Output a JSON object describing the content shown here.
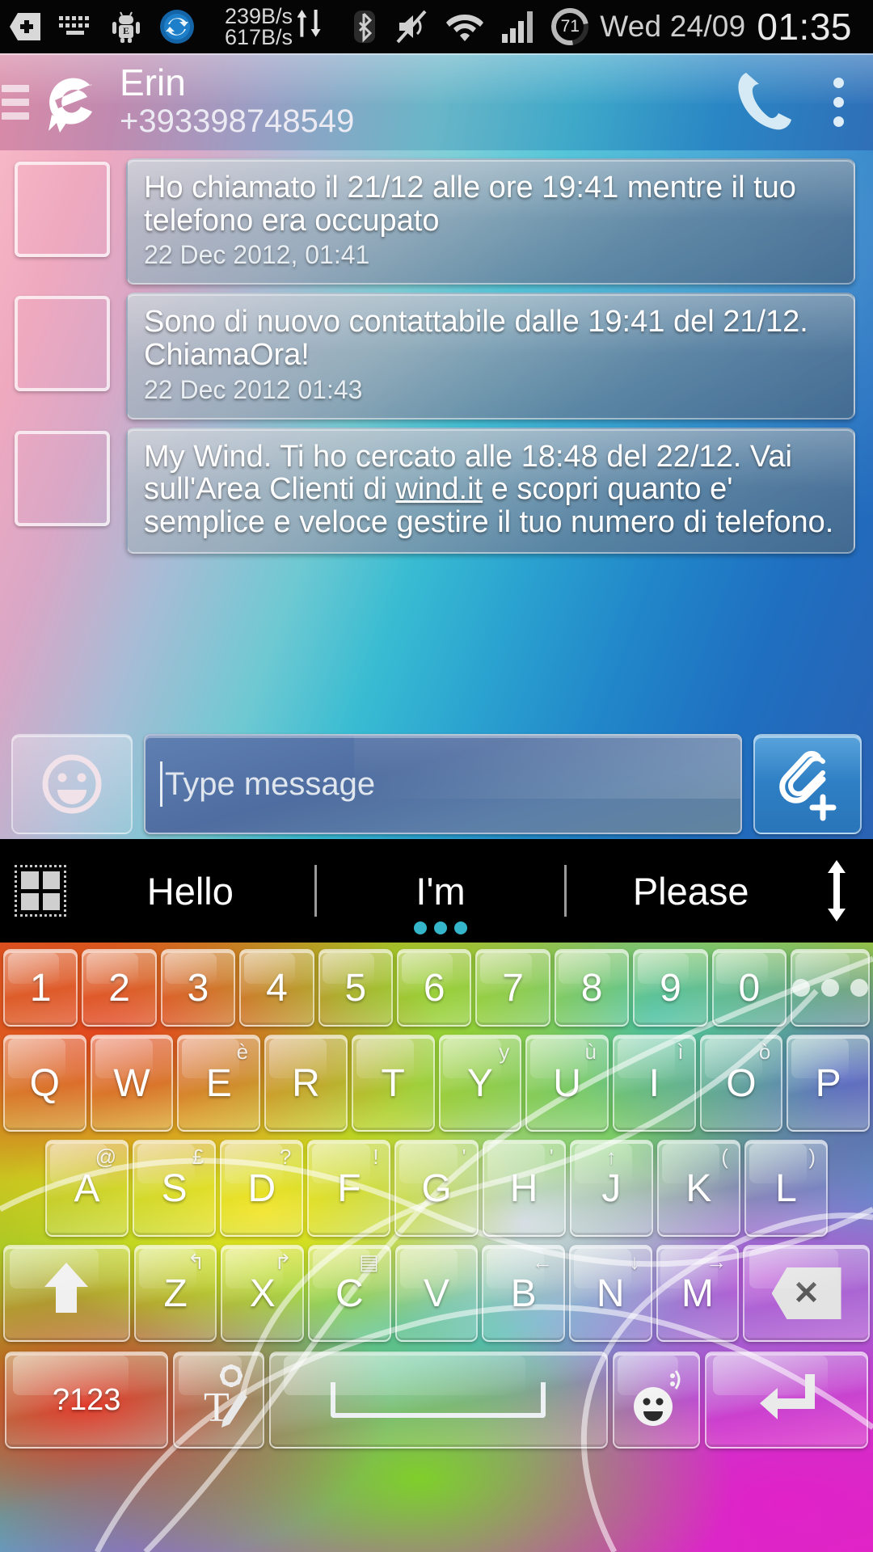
{
  "status_bar": {
    "icons": [
      "plus-badge-icon",
      "keyboard-icon",
      "android-e-icon",
      "sync-icon"
    ],
    "net_down": "239B/s",
    "net_up": "617B/s",
    "bluetooth": "bluetooth-icon",
    "mute": "mute-icon",
    "wifi": "wifi-icon",
    "signal": "signal-icon",
    "battery_percent": "71",
    "date": "Wed 24/09",
    "time": "01:35"
  },
  "app_bar": {
    "contact_name": "Erin",
    "contact_number": "+393398748549",
    "logo": "e-logo-icon",
    "call_icon": "phone-icon",
    "overflow_icon": "more-vertical-icon"
  },
  "messages": [
    {
      "text": "Ho chiamato il 21/12 alle ore 19:41 mentre il tuo telefono era occupato",
      "timestamp": "22 Dec 2012, 01:41",
      "link": ""
    },
    {
      "text": "Sono di nuovo contattabile dalle 19:41 del 21/12. ChiamaOra!",
      "timestamp": "22 Dec 2012 01:43",
      "link": ""
    },
    {
      "text_before": "My Wind. Ti ho cercato alle 18:48 del 22/12.\nVai sull'Area Clienti di ",
      "link": "wind.it",
      "text_after": " e scopri quanto e' semplice e veloce gestire il tuo numero di telefono.",
      "timestamp": ""
    }
  ],
  "input_bar": {
    "emoji_icon": "smiley-icon",
    "placeholder": "Type message",
    "value": "",
    "attach_icon": "paperclip-plus-icon"
  },
  "suggestion_bar": {
    "grid_icon": "grid-icon",
    "suggestions": [
      "Hello",
      "I'm",
      "Please"
    ],
    "active_index": 1,
    "expand_icon": "up-down-arrow-icon",
    "dot_color": "#35b5c9"
  },
  "keyboard": {
    "rows": {
      "numbers": [
        {
          "label": "1"
        },
        {
          "label": "2"
        },
        {
          "label": "3"
        },
        {
          "label": "4"
        },
        {
          "label": "5"
        },
        {
          "label": "6"
        },
        {
          "label": "7"
        },
        {
          "label": "8"
        },
        {
          "label": "9"
        },
        {
          "label": "0"
        },
        {
          "label": "",
          "icon": "more-dots-icon"
        }
      ],
      "qwerty": [
        {
          "label": "Q",
          "hint": ""
        },
        {
          "label": "W",
          "hint": ""
        },
        {
          "label": "E",
          "hint": "è"
        },
        {
          "label": "R",
          "hint": ""
        },
        {
          "label": "T",
          "hint": ""
        },
        {
          "label": "Y",
          "hint": "y"
        },
        {
          "label": "U",
          "hint": "ù"
        },
        {
          "label": "I",
          "hint": "ì"
        },
        {
          "label": "O",
          "hint": "ò"
        },
        {
          "label": "P",
          "hint": ""
        }
      ],
      "home": [
        {
          "label": "A",
          "hint": "@"
        },
        {
          "label": "S",
          "hint": "£"
        },
        {
          "label": "D",
          "hint": "?"
        },
        {
          "label": "F",
          "hint": "!"
        },
        {
          "label": "G",
          "hint": "'"
        },
        {
          "label": "H",
          "hint": "'"
        },
        {
          "label": "J",
          "hint": "↑"
        },
        {
          "label": "K",
          "hint": "("
        },
        {
          "label": "L",
          "hint": ")"
        }
      ],
      "bottom_letters": [
        {
          "label": "",
          "icon": "shift-icon",
          "hint": ""
        },
        {
          "label": "Z",
          "hint": "↰"
        },
        {
          "label": "X",
          "hint": "↱"
        },
        {
          "label": "C",
          "hint": "▤"
        },
        {
          "label": "V",
          "hint": ""
        },
        {
          "label": "B",
          "hint": "←"
        },
        {
          "label": "N",
          "hint": "↓"
        },
        {
          "label": "M",
          "hint": "→"
        },
        {
          "label": "",
          "icon": "backspace-icon",
          "hint": ""
        }
      ],
      "space_row": [
        {
          "label": "?123",
          "icon": ""
        },
        {
          "label": "",
          "icon": "handwriting-settings-icon"
        },
        {
          "label": "",
          "icon": "spacebar-icon"
        },
        {
          "label": "",
          "icon": "emoji-icon"
        },
        {
          "label": "",
          "icon": "enter-icon"
        }
      ]
    }
  }
}
